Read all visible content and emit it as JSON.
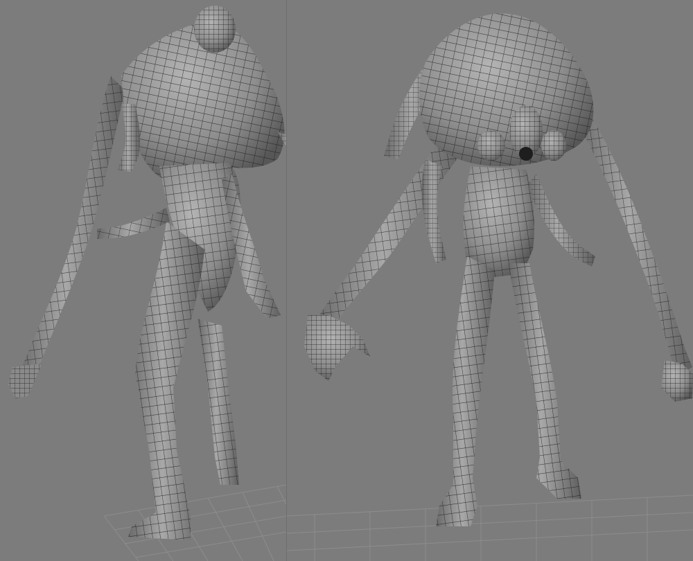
{
  "viewports": [
    {
      "id": "left",
      "view": "perspective",
      "model": "creature-wireframe-rear-three-quarter"
    },
    {
      "id": "right",
      "view": "perspective",
      "model": "creature-wireframe-front"
    }
  ],
  "colors": {
    "background": "#7c7c7c",
    "grid_line": "#8c8c8c",
    "mesh_fill_light": "#a8a8a8",
    "mesh_fill_dark": "#5a5a5a",
    "wire": "#1e1e1e"
  }
}
